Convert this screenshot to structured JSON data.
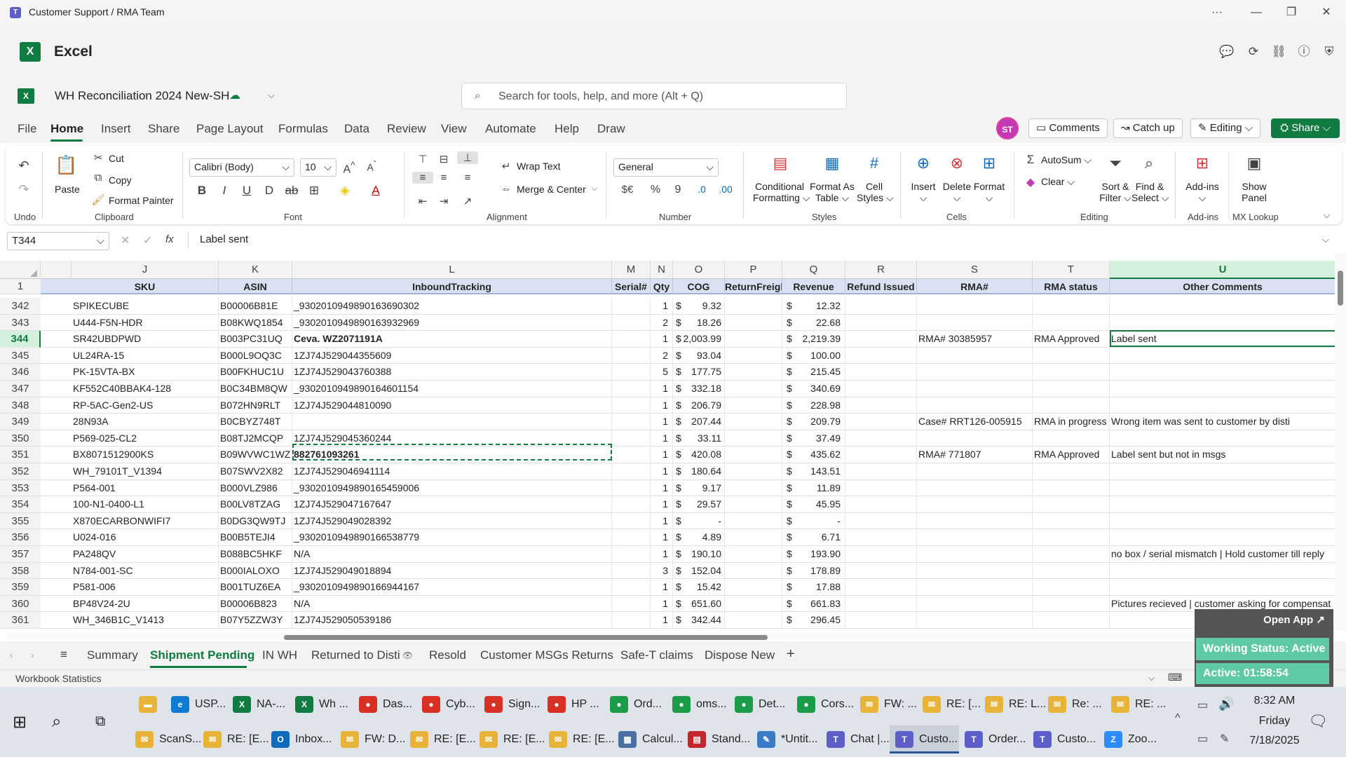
{
  "titlebar": {
    "title": "Customer Support / RMA Team",
    "more": "···",
    "minimize": "—",
    "maximize": "❐",
    "close": "✕"
  },
  "app": {
    "name": "Excel"
  },
  "file": {
    "name": "WH Reconciliation 2024 New-SH"
  },
  "search": {
    "placeholder": "Search for tools, help, and more (Alt + Q)"
  },
  "tabs": [
    "File",
    "Home",
    "Insert",
    "Share",
    "Page Layout",
    "Formulas",
    "Data",
    "Review",
    "View",
    "Automate",
    "Help",
    "Draw"
  ],
  "user": {
    "initials": "ST"
  },
  "actions": {
    "comments": "Comments",
    "catchup": "Catch up",
    "editing": "Editing",
    "share": "Share"
  },
  "ribbon": {
    "undo_group": "Undo",
    "paste": "Paste",
    "cut": "Cut",
    "copy": "Copy",
    "format_painter": "Format Painter",
    "clipboard_group": "Clipboard",
    "font_name": "Calibri (Body)",
    "font_size": "10",
    "font_group": "Font",
    "wrap_text": "Wrap Text",
    "merge_center": "Merge & Center",
    "alignment_group": "Alignment",
    "number_format": "General",
    "number_group": "Number",
    "cond_format_1": "Conditional",
    "cond_format_2": "Formatting",
    "format_table_1": "Format As",
    "format_table_2": "Table",
    "cell_styles_1": "Cell",
    "cell_styles_2": "Styles",
    "styles_group": "Styles",
    "insert": "Insert",
    "delete": "Delete",
    "format": "Format",
    "cells_group": "Cells",
    "autosum": "AutoSum",
    "clear": "Clear",
    "sort_1": "Sort &",
    "sort_2": "Filter",
    "find_1": "Find &",
    "find_2": "Select",
    "editing_group": "Editing",
    "addins": "Add-ins",
    "addins_group": "Add-ins",
    "show_panel_1": "Show",
    "show_panel_2": "Panel",
    "mxlookup_group": "MX Lookup"
  },
  "formula_bar": {
    "name_box": "T344",
    "fx": "fx",
    "content": "Label sent"
  },
  "columns": [
    {
      "letter": "J"
    },
    {
      "letter": "K"
    },
    {
      "letter": "L"
    },
    {
      "letter": "M"
    },
    {
      "letter": "N"
    },
    {
      "letter": "O"
    },
    {
      "letter": "P"
    },
    {
      "letter": "Q"
    },
    {
      "letter": "R"
    },
    {
      "letter": "S"
    },
    {
      "letter": "T"
    },
    {
      "letter": "U"
    }
  ],
  "header_row_num": "1",
  "headers": [
    "SKU",
    "ASIN",
    "InboundTracking",
    "Serial#",
    "Qty",
    "COG",
    "ReturnFreight",
    "Revenue",
    "Refund Issued",
    "RMA#",
    "RMA status",
    "Other Comments"
  ],
  "rows": [
    {
      "n": "342",
      "sku": "SPIKECUBE",
      "asin": "B00006B81E",
      "track": "_9302010949890163690302",
      "qty": "1",
      "cog": "9.32",
      "rev": "12.32",
      "rma": "",
      "status": "",
      "comment": ""
    },
    {
      "n": "343",
      "sku": "U444-F5N-HDR",
      "asin": "B08KWQ1854",
      "track": "_9302010949890163932969",
      "qty": "2",
      "cog": "18.26",
      "rev": "22.68",
      "rma": "",
      "status": "",
      "comment": ""
    },
    {
      "n": "344",
      "sku": "SR42UBDPWD",
      "asin": "B003PC31UQ",
      "track": "Ceva. WZ2071191A",
      "qty": "1",
      "cog": "2,003.99",
      "rev": "2,219.39",
      "rma": "RMA# 30385957",
      "status": "RMA Approved",
      "comment": "Label sent"
    },
    {
      "n": "345",
      "sku": "UL24RA-15",
      "asin": "B000L9OQ3C",
      "track": "1ZJ74J529044355609",
      "qty": "2",
      "cog": "93.04",
      "rev": "100.00",
      "rma": "",
      "status": "",
      "comment": ""
    },
    {
      "n": "346",
      "sku": "PK-15VTA-BX",
      "asin": "B00FKHUC1U",
      "track": "1ZJ74J529043760388",
      "qty": "5",
      "cog": "177.75",
      "rev": "215.45",
      "rma": "",
      "status": "",
      "comment": ""
    },
    {
      "n": "347",
      "sku": "KF552C40BBAK4-128",
      "asin": "B0C34BM8QW",
      "track": "_9302010949890164601154",
      "qty": "1",
      "cog": "332.18",
      "rev": "340.69",
      "rma": "",
      "status": "",
      "comment": ""
    },
    {
      "n": "348",
      "sku": "RP-5AC-Gen2-US",
      "asin": "B072HN9RLT",
      "track": "1ZJ74J529044810090",
      "qty": "1",
      "cog": "206.79",
      "rev": "228.98",
      "rma": "",
      "status": "",
      "comment": ""
    },
    {
      "n": "349",
      "sku": "28N93A",
      "asin": "B0CBYZ748T",
      "track": "",
      "qty": "1",
      "cog": "207.44",
      "rev": "209.79",
      "rma": "Case# RRT126-005915",
      "status": "RMA in progress",
      "comment": "Wrong item was sent to customer by disti"
    },
    {
      "n": "350",
      "sku": "P569-025-CL2",
      "asin": "B08TJ2MCQP",
      "track": "1ZJ74J529045360244",
      "qty": "1",
      "cog": "33.11",
      "rev": "37.49",
      "rma": "",
      "status": "",
      "comment": ""
    },
    {
      "n": "351",
      "sku": "BX8071512900KS",
      "asin": "B09WVWC1WZ",
      "track": "882761093261",
      "qty": "1",
      "cog": "420.08",
      "rev": "435.62",
      "rma": "RMA# 771807",
      "status": "RMA Approved",
      "comment": "Label sent but not in msgs"
    },
    {
      "n": "352",
      "sku": "WH_79101T_V1394",
      "asin": "B07SWV2X82",
      "track": "1ZJ74J529046941114",
      "qty": "1",
      "cog": "180.64",
      "rev": "143.51",
      "rma": "",
      "status": "",
      "comment": ""
    },
    {
      "n": "353",
      "sku": "P564-001",
      "asin": "B000VLZ986",
      "track": "_9302010949890165459006",
      "qty": "1",
      "cog": "9.17",
      "rev": "11.89",
      "rma": "",
      "status": "",
      "comment": ""
    },
    {
      "n": "354",
      "sku": "100-N1-0400-L1",
      "asin": "B00LV8TZAG",
      "track": "1ZJ74J529047167647",
      "qty": "1",
      "cog": "29.57",
      "rev": "45.95",
      "rma": "",
      "status": "",
      "comment": ""
    },
    {
      "n": "355",
      "sku": "X870ECARBONWIFI7",
      "asin": "B0DG3QW9TJ",
      "track": "1ZJ74J529049028392",
      "qty": "1",
      "cog": "-",
      "rev": "-",
      "rma": "",
      "status": "",
      "comment": ""
    },
    {
      "n": "356",
      "sku": "U024-016",
      "asin": "B00B5TEJI4",
      "track": "_9302010949890166538779",
      "qty": "1",
      "cog": "4.89",
      "rev": "6.71",
      "rma": "",
      "status": "",
      "comment": ""
    },
    {
      "n": "357",
      "sku": "PA248QV",
      "asin": "B088BC5HKF",
      "track": "N/A",
      "qty": "1",
      "cog": "190.10",
      "rev": "193.90",
      "rma": "",
      "status": "",
      "comment": "no box / serial mismatch  | Hold customer till reply"
    },
    {
      "n": "358",
      "sku": "N784-001-SC",
      "asin": "B000IALOXO",
      "track": "1ZJ74J529049018894",
      "qty": "3",
      "cog": "152.04",
      "rev": "178.89",
      "rma": "",
      "status": "",
      "comment": ""
    },
    {
      "n": "359",
      "sku": "P581-006",
      "asin": "B001TUZ6EA",
      "track": "_9302010949890166944167",
      "qty": "1",
      "cog": "15.42",
      "rev": "17.88",
      "rma": "",
      "status": "",
      "comment": ""
    },
    {
      "n": "360",
      "sku": "BP48V24-2U",
      "asin": "B00006B823",
      "track": "N/A",
      "qty": "1",
      "cog": "651.60",
      "rev": "661.83",
      "rma": "",
      "status": "",
      "comment": "Pictures recieved | customer asking for compensat"
    },
    {
      "n": "361",
      "sku": "WH_346B1C_V1413",
      "asin": "B07Y5ZZW3Y",
      "track": "1ZJ74J529050539186",
      "qty": "1",
      "cog": "342.44",
      "rev": "296.45",
      "rma": "",
      "status": "",
      "comment": ""
    }
  ],
  "currency_symbol": "$",
  "sheet_tabs": [
    "Summary",
    "Shipment Pending",
    "IN WH",
    "Returned to Disti",
    "Resold",
    "Customer MSGs Returns",
    "Safe-T claims",
    "Dispose New"
  ],
  "status_bar": {
    "text": "Workbook Statistics"
  },
  "widget": {
    "open_app": "Open App ↗",
    "status": "Working Status: Active",
    "active": "Active: 01:58:54"
  },
  "taskbar": {
    "row1": [
      {
        "label": "",
        "color": "#e8b339",
        "ico": "▬"
      },
      {
        "label": "USP...",
        "color": "#0c7bd1",
        "ico": "e"
      },
      {
        "label": "NA-...",
        "color": "#107c41",
        "ico": "X"
      },
      {
        "label": "Wh ...",
        "color": "#107c41",
        "ico": "X"
      },
      {
        "label": "Das...",
        "color": "#d93025",
        "ico": "●"
      },
      {
        "label": "Cyb...",
        "color": "#d93025",
        "ico": "●"
      },
      {
        "label": "Sign...",
        "color": "#d93025",
        "ico": "●"
      },
      {
        "label": "HP ...",
        "color": "#d93025",
        "ico": "●"
      },
      {
        "label": "Ord...",
        "color": "#1a9c48",
        "ico": "●"
      },
      {
        "label": "oms...",
        "color": "#1a9c48",
        "ico": "●"
      },
      {
        "label": "Det...",
        "color": "#1a9c48",
        "ico": "●"
      },
      {
        "label": "Cors...",
        "color": "#1a9c48",
        "ico": "●"
      },
      {
        "label": "FW: ...",
        "color": "#e8b339",
        "ico": "✉"
      },
      {
        "label": "RE: [...",
        "color": "#e8b339",
        "ico": "✉"
      },
      {
        "label": "RE: L...",
        "color": "#e8b339",
        "ico": "✉"
      },
      {
        "label": "Re: ...",
        "color": "#e8b339",
        "ico": "✉"
      },
      {
        "label": "RE: ...",
        "color": "#e8b339",
        "ico": "✉"
      }
    ],
    "row2": [
      {
        "label": "ScanS...",
        "color": "#e8b339",
        "ico": "✉"
      },
      {
        "label": "RE: [E...",
        "color": "#e8b339",
        "ico": "✉"
      },
      {
        "label": "Inbox...",
        "color": "#0f6cbd",
        "ico": "O"
      },
      {
        "label": "FW: D...",
        "color": "#e8b339",
        "ico": "✉"
      },
      {
        "label": "RE: [E...",
        "color": "#e8b339",
        "ico": "✉"
      },
      {
        "label": "RE: [E...",
        "color": "#e8b339",
        "ico": "✉"
      },
      {
        "label": "RE: [E...",
        "color": "#e8b339",
        "ico": "✉"
      },
      {
        "label": "Calcul...",
        "color": "#4a6fa5",
        "ico": "▦"
      },
      {
        "label": "Stand...",
        "color": "#c4262e",
        "ico": "▤"
      },
      {
        "label": "*Untit...",
        "color": "#3a7bc8",
        "ico": "✎"
      },
      {
        "label": "Chat |...",
        "color": "#5b5fc7",
        "ico": "T"
      },
      {
        "label": "Custo...",
        "color": "#5b5fc7",
        "ico": "T"
      },
      {
        "label": "Order...",
        "color": "#5b5fc7",
        "ico": "T"
      },
      {
        "label": "Custo...",
        "color": "#5b5fc7",
        "ico": "T"
      },
      {
        "label": "Zoo...",
        "color": "#2d8cff",
        "ico": "Z"
      }
    ],
    "time": "8:32 AM",
    "day": "Friday",
    "date": "7/18/2025"
  }
}
